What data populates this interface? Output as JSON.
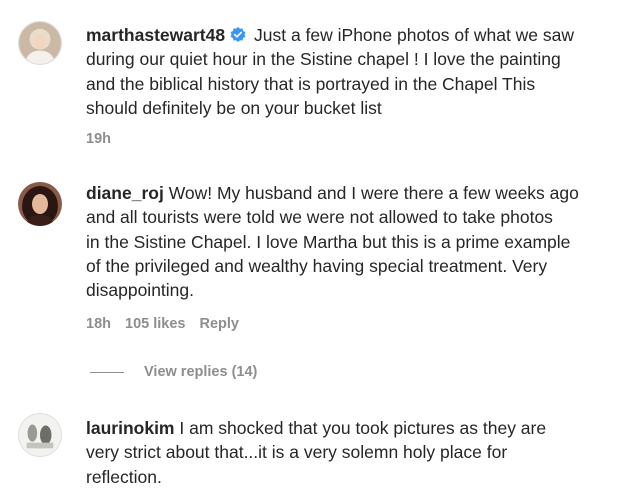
{
  "comments": [
    {
      "username": "marthastewart48",
      "verified": true,
      "text": "Just a few iPhone photos of what we saw\nduring our quiet hour in the Sistine chapel ! I love the painting\nand the biblical history that is portrayed in the Chapel This\nshould definitely be on your bucket list",
      "time": "19h"
    },
    {
      "username": "diane_roj",
      "verified": false,
      "text": "Wow! My husband and I were there a few weeks ago\nand all tourists were told we were not allowed to take photos\nin the Sistine Chapel. I love Martha but this is a prime example\nof the privileged and wealthy having special treatment. Very\ndisappointing.",
      "time": "18h",
      "likes": "105 likes",
      "reply": "Reply",
      "view_replies": "View replies (14)"
    },
    {
      "username": "laurinokim",
      "verified": false,
      "text": "I am shocked that you took pictures as they are\nvery strict about that...it is a very solemn holy place for\nreflection."
    }
  ]
}
